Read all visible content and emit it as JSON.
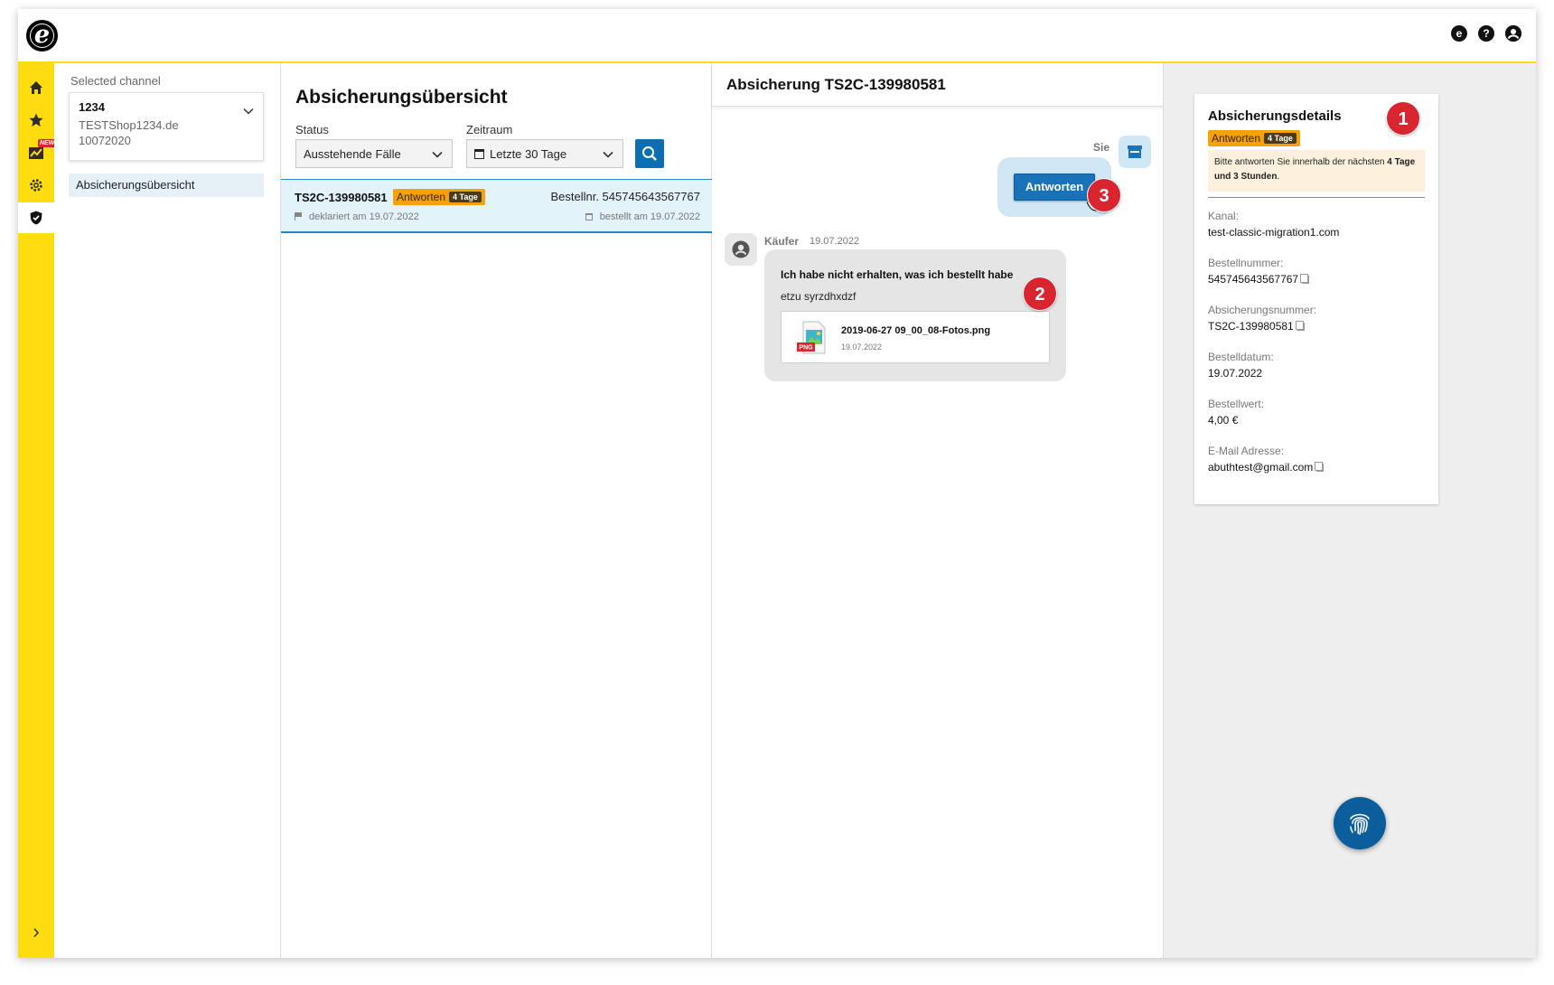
{
  "rail": {
    "items": [
      "home-icon",
      "star-icon",
      "chart-new-icon",
      "gear-icon",
      "shield-icon"
    ],
    "new_badge": "NEW",
    "expand": "›"
  },
  "channel": {
    "label": "Selected channel",
    "id": "1234",
    "shop": "TESTShop1234.de",
    "number": "10072020",
    "nav_item": "Absicherungsübersicht"
  },
  "list": {
    "title": "Absicherungsübersicht",
    "status_label": "Status",
    "status_value": "Ausstehende Fälle",
    "period_label": "Zeitraum",
    "period_value": "Letzte 30 Tage",
    "case": {
      "id": "TS2C-139980581",
      "badge_label": "Antworten",
      "badge_days": "4 Tage",
      "order": "Bestellnr. 545745643567767",
      "declared": "deklariert am 19.07.2022",
      "ordered": "bestellt am 19.07.2022"
    }
  },
  "conversation": {
    "title": "Absicherung TS2C-139980581",
    "me_label": "Sie",
    "reply_button": "Antworten",
    "buyer_name": "Käufer",
    "buyer_date": "19.07.2022",
    "subject": "Ich habe nicht erhalten, was ich bestellt habe",
    "body": "etzu syrzdhxdzf",
    "attachment_name": "2019-06-27 09_00_08-Fotos.png",
    "attachment_date": "19.07.2022",
    "attachment_type": "PNG"
  },
  "details": {
    "title": "Absicherungsdetails",
    "badge_label": "Antworten",
    "badge_days": "4 Tage",
    "notice_pre": "Bitte antworten Sie innerhalb der nächsten ",
    "notice_bold": "4 Tage und 3 Stunden",
    "notice_post": ".",
    "fields": [
      {
        "label": "Kanal:",
        "value": "test-classic-migration1.com"
      },
      {
        "label": "Bestellnummer:",
        "value": "545745643567767"
      },
      {
        "label": "Absicherungsnummer:",
        "value": "TS2C-139980581"
      },
      {
        "label": "Bestelldatum:",
        "value": "19.07.2022"
      },
      {
        "label": "Bestellwert:",
        "value": "4,00 €"
      },
      {
        "label": "E-Mail Adresse:",
        "value": "abuthtest@gmail.com"
      }
    ]
  },
  "markers": [
    "1",
    "2",
    "3"
  ],
  "colors": {
    "brand_yellow": "#ffdc0f",
    "primary_blue": "#1a73b8",
    "badge_orange": "#f4a10a",
    "marker_red": "#d9252f"
  }
}
